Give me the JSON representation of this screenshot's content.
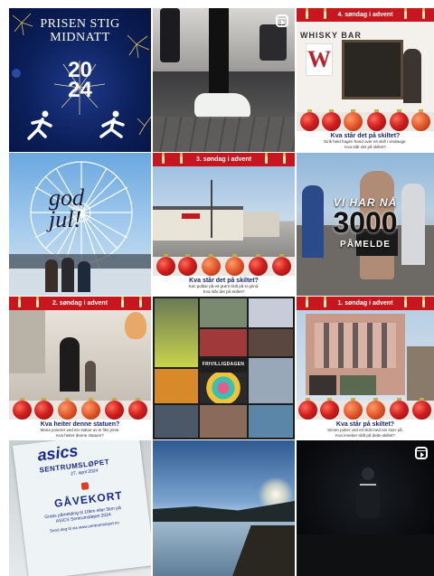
{
  "posts": [
    {
      "title_line1": "PRISEN STIG",
      "title_line2": "MIDNATT",
      "year_top": "20",
      "year_bottom": "24"
    },
    {
      "type": "reel"
    },
    {
      "banner": "4. søndag i advent",
      "sign": "WHISKY BAR",
      "sign_logo": "W",
      "question": "Kva står det på skiltet?",
      "sub1": "Eirik held hagen hand over eit skilt i vindauge.",
      "sub2": "Kva står det på skiltet?"
    },
    {
      "text": "god jul!"
    },
    {
      "banner": "3. søndag i advent",
      "question": "Kva står det på skiltet?",
      "sub1": "Kari polkar på eit grønt skilt på ei grind.",
      "sub2": "Kva står det på skiltet?"
    },
    {
      "headline": "VI HAR NÅ",
      "number": "3000",
      "subline": "PÅMELDE"
    },
    {
      "banner": "2. søndag i advent",
      "question": "Kva heiter denne statuen?",
      "sub1": "Maria poserer ved ein statue av ei fiks jente.",
      "sub2": "Kva heiter denne statuen?"
    },
    {
      "label": "FRIVILLIGDAGEN"
    },
    {
      "banner": "1. søndag i advent",
      "question": "Kva står på skiltet?",
      "sub1": "Simen poker ved eit skilt med ein storr på.",
      "sub2": "Kva inneber skilt på dette skiltet?"
    },
    {
      "brand": "asics",
      "event": "SENTRUMSLØPET",
      "date": "27. april 2024",
      "card_title": "GÅVEKORT",
      "card_text": "Gratis påmelding til 10km eller 5km på ASICS Sentrumsløpet 2024",
      "card_text2": "Send deg til via www.sentrumslopet.no"
    },
    {
      "type": "landscape"
    },
    {
      "type": "reel"
    }
  ]
}
